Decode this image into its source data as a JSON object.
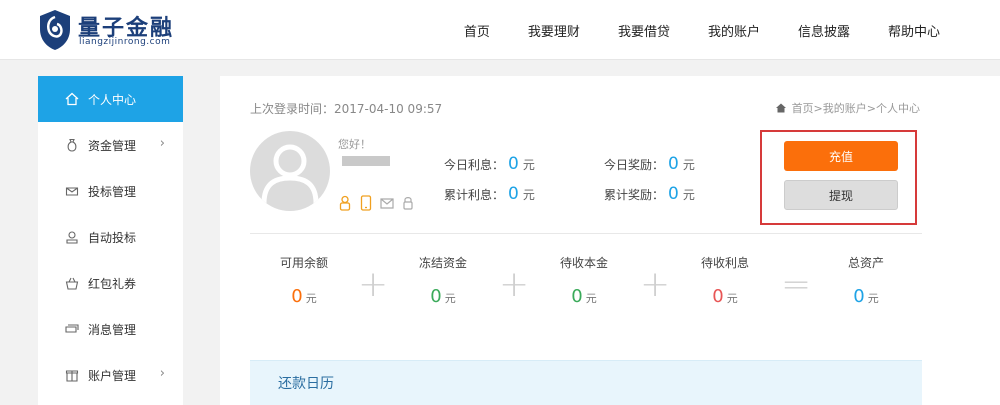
{
  "header": {
    "logo_cn": "量子金融",
    "logo_en": "liangzijinrong.com",
    "nav": [
      "首页",
      "我要理财",
      "我要借贷",
      "我的账户",
      "信息披露",
      "帮助中心"
    ]
  },
  "sidebar": {
    "items": [
      {
        "label": "个人中心",
        "icon": "home-icon",
        "active": true,
        "arrow": false
      },
      {
        "label": "资金管理",
        "icon": "money-bag-icon",
        "active": false,
        "arrow": true
      },
      {
        "label": "投标管理",
        "icon": "envelope-icon",
        "active": false,
        "arrow": false
      },
      {
        "label": "自动投标",
        "icon": "auto-bid-icon",
        "active": false,
        "arrow": false
      },
      {
        "label": "红包礼券",
        "icon": "gift-basket-icon",
        "active": false,
        "arrow": false
      },
      {
        "label": "消息管理",
        "icon": "message-icon",
        "active": false,
        "arrow": false
      },
      {
        "label": "账户管理",
        "icon": "gift-box-icon",
        "active": false,
        "arrow": true
      }
    ],
    "arrow_glyph": "›"
  },
  "main": {
    "last_login": "上次登录时间：2017-04-10 09:57",
    "breadcrumb": "首页>我的账户>个人中心",
    "greeting": "您好！",
    "stats": {
      "today_interest_label": "今日利息：",
      "today_interest_value": "0",
      "total_interest_label": "累计利息：",
      "total_interest_value": "0",
      "today_reward_label": "今日奖励：",
      "today_reward_value": "0",
      "total_reward_label": "累计奖励：",
      "total_reward_value": "0",
      "unit": "元"
    },
    "buttons": {
      "recharge": "充值",
      "withdraw": "提现"
    },
    "balances": [
      {
        "label": "可用余额",
        "value": "0",
        "color": "#fb6f0b"
      },
      {
        "label": "冻结资金",
        "value": "0",
        "color": "#3aaa5a"
      },
      {
        "label": "待收本金",
        "value": "0",
        "color": "#3aaa5a"
      },
      {
        "label": "待收利息",
        "value": "0",
        "color": "#e85555"
      },
      {
        "label": "总资产",
        "value": "0",
        "color": "#1ea3e6"
      }
    ],
    "balance_unit": "元",
    "operators": [
      "+",
      "+",
      "+",
      "="
    ],
    "calendar_title": "还款日历"
  },
  "colors": {
    "accent": "#1ea3e6",
    "recharge": "#fb6f0b",
    "highlight_box": "#d63a3a"
  }
}
